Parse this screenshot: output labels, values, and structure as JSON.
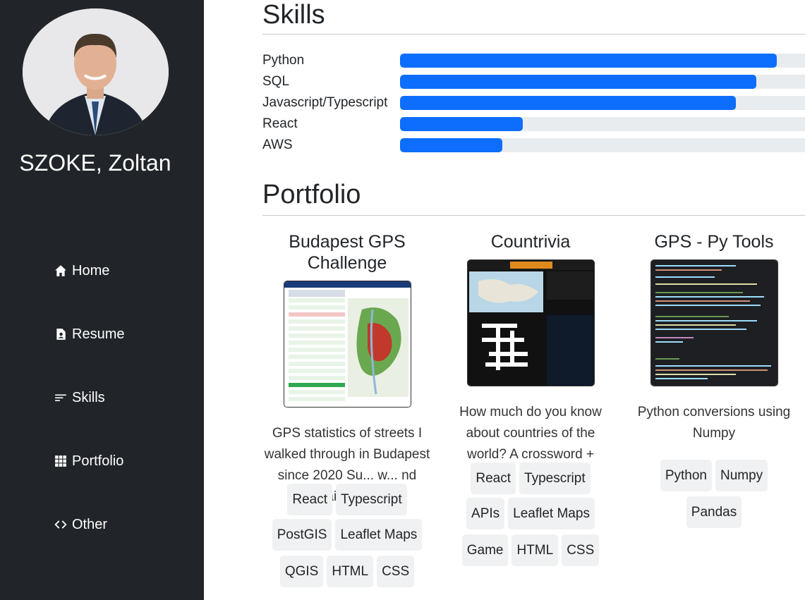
{
  "profile": {
    "name": "SZOKE, Zoltan"
  },
  "nav": [
    {
      "label": "Home",
      "icon": "house-icon"
    },
    {
      "label": "Resume",
      "icon": "resume-icon"
    },
    {
      "label": "Skills",
      "icon": "skills-icon"
    },
    {
      "label": "Portfolio",
      "icon": "grid-icon"
    },
    {
      "label": "Other",
      "icon": "code-icon"
    }
  ],
  "skills": {
    "title": "Skills",
    "bar_color": "#0d6efd",
    "track_color": "#e9ecef",
    "items": [
      {
        "label": "Python",
        "level": 0.92
      },
      {
        "label": "SQL",
        "level": 0.87
      },
      {
        "label": "Javascript/Typescript",
        "level": 0.82
      },
      {
        "label": "React",
        "level": 0.3
      },
      {
        "label": "AWS",
        "level": 0.25
      }
    ]
  },
  "portfolio": {
    "title": "Portfolio",
    "cards": [
      {
        "title": "Budapest GPS Challenge",
        "description": "GPS statistics of streets I walked through in Budapest since 2020 Su... w... nd detailed stats",
        "tags": [
          "React",
          "Typescript",
          "PostGIS",
          "Leaflet Maps",
          "QGIS",
          "HTML",
          "CSS"
        ]
      },
      {
        "title": "Countrivia",
        "description": "How much do you know about countries of the world? A crossword +",
        "tags": [
          "React",
          "Typescript",
          "APIs",
          "Leaflet Maps",
          "Game",
          "HTML",
          "CSS"
        ]
      },
      {
        "title": "GPS - Py Tools",
        "description": "Python conversions using Numpy",
        "tags": [
          "Python",
          "Numpy",
          "Pandas"
        ]
      }
    ]
  }
}
